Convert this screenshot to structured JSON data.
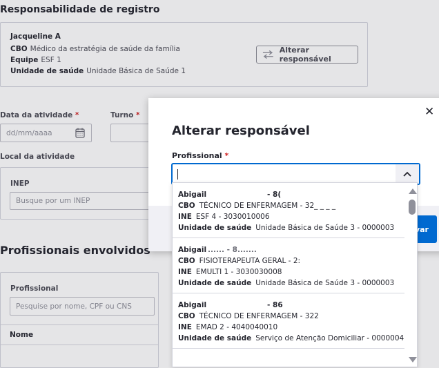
{
  "background": {
    "section_title": "Responsabilidade de registro",
    "responsible": {
      "name": "Jacqueline A",
      "cbo_label": "CBO",
      "cbo_value": "Médico da estratégia de saúde da família",
      "equipe_label": "Equipe",
      "equipe_value": "ESF 1",
      "unidade_label": "Unidade de saúde",
      "unidade_value": "Unidade Básica de Saúde 1",
      "change_button": "Alterar responsável"
    },
    "data_label": "Data da atividade",
    "data_placeholder": "dd/mm/aaaa",
    "turno_label": "Turno",
    "required_mark": "*",
    "local_label": "Local da atividade",
    "inep_label": "INEP",
    "inep_placeholder": "Busque por um INEP",
    "profissionais_title": "Profissionais envolvidos",
    "profissional_label": "Profissional",
    "profissional_placeholder": "Pesquise por nome, CPF ou CNS",
    "nome_header": "Nome"
  },
  "modal": {
    "title": "Alterar responsável",
    "close_glyph": "✕",
    "field_label": "Profissional",
    "required_mark": "*",
    "save_button": "var",
    "options": [
      {
        "name": "Abigail",
        "name_suffix": "- 8(",
        "cbo_label": "CBO",
        "cbo": "TÉCNICO DE ENFERMAGEM - 32_ _ _ _",
        "ine_label": "INE",
        "ine": "ESF 4 - 3030010006",
        "unidade_label": "Unidade de saúde",
        "unidade": "Unidade Básica de Saúde 3 - 0000003"
      },
      {
        "name": "Abigail",
        "name_suffix": "...... - 8.......",
        "cbo_label": "CBO",
        "cbo": "FISIOTERAPEUTA GERAL - 2:",
        "ine_label": "INE",
        "ine": "EMULTI 1 - 3030030008",
        "unidade_label": "Unidade de saúde",
        "unidade": "Unidade Básica de Saúde 3 - 0000003"
      },
      {
        "name": "Abigail",
        "name_suffix": "- 86",
        "cbo_label": "CBO",
        "cbo": "TÉCNICO DE ENFERMAGEM - 322",
        "ine_label": "INE",
        "ine": "EMAD 2 - 4040040010",
        "unidade_label": "Unidade de saúde",
        "unidade": "Serviço de Atenção Domiciliar - 0000004"
      }
    ]
  },
  "colors": {
    "primary": "#0069d0",
    "required": "#d01e1e",
    "border": "#d3d4dd"
  }
}
